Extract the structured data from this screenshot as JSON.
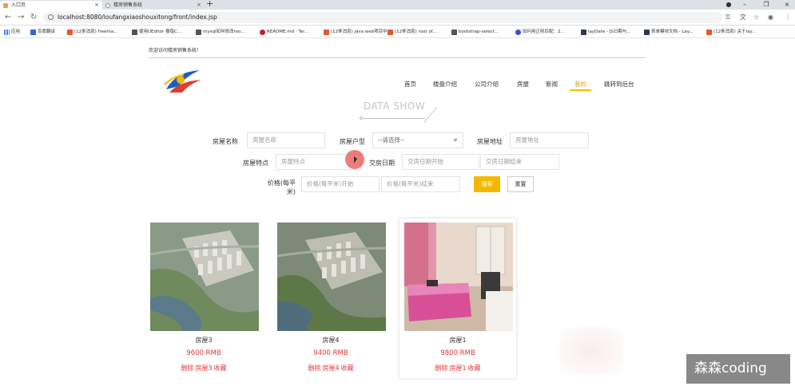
{
  "browser": {
    "tabs": [
      {
        "title": "入口页",
        "active": true,
        "favicon_color": "#e8a33d"
      },
      {
        "title": "楼房销售系统",
        "active": false,
        "favicon_color": "#888888"
      }
    ],
    "url": "localhost:8080/loufangxiaoshouxitong/front/index.jsp",
    "bookmarks": [
      {
        "label": "应用",
        "icon_color": "#4285f4"
      },
      {
        "label": "百度翻译",
        "icon_color": "#2b6cd8"
      },
      {
        "label": "(12条消息) freema...",
        "icon_color": "#e8562d"
      },
      {
        "label": "使用UEditor 报错C...",
        "icon_color": "#555555"
      },
      {
        "label": "mysql如何修改roo...",
        "icon_color": "#555555"
      },
      {
        "label": "README.md · Ter...",
        "icon_color": "#c71d23"
      },
      {
        "label": "(12条消息) java web项目中...",
        "icon_color": "#e8562d"
      },
      {
        "label": "(12条消息) root of...",
        "icon_color": "#e8562d"
      },
      {
        "label": "bootstrap-select...",
        "icon_color": "#555555"
      },
      {
        "label": "如何用正则匹配：2...",
        "icon_color": "#3a4fcf"
      },
      {
        "label": "layDate - JS日期与...",
        "icon_color": "#2b3a4f"
      },
      {
        "label": "表单模块文档 - Lay...",
        "icon_color": "#2b3a4f"
      },
      {
        "label": "(12条消息) 关于lay...",
        "icon_color": "#e8562d"
      }
    ]
  },
  "header": {
    "welcome": "欢迎访问楼房销售系统！",
    "nav": [
      "首页",
      "楼盘介绍",
      "公司介绍",
      "房屋",
      "新闻",
      "我的",
      "跳转到后台"
    ],
    "active_nav": "我的",
    "section_title": "DATA SHOW"
  },
  "search": {
    "name_label": "房屋名称",
    "name_placeholder": "房屋名称",
    "type_label": "房屋户型",
    "type_selected": "--请选择--",
    "address_label": "房屋地址",
    "address_placeholder": "房屋地址",
    "feature_label": "房屋特点",
    "feature_placeholder": "房屋特点",
    "date_label": "交房日期",
    "date_start_placeholder": "交房日期开始",
    "date_end_placeholder": "交房日期结束",
    "price_label_line1": "价格(每平",
    "price_label_line2": "米)",
    "price_start_placeholder": "价格(每平米)开始",
    "price_end_placeholder": "价格(每平米)结束",
    "search_button": "搜索",
    "reset_button": "重置",
    "accent_color": "#f5b800"
  },
  "houses": [
    {
      "name": "房屋3",
      "price": "9600 RMB",
      "delete": "删除",
      "tag": "房屋3",
      "collect": "收藏"
    },
    {
      "name": "房屋4",
      "price": "9400 RMB",
      "delete": "删除",
      "tag": "房屋4",
      "collect": "收藏"
    },
    {
      "name": "房屋1",
      "price": "9800 RMB",
      "delete": "删除",
      "tag": "房屋1",
      "collect": "收藏"
    }
  ],
  "watermark": "森森coding"
}
